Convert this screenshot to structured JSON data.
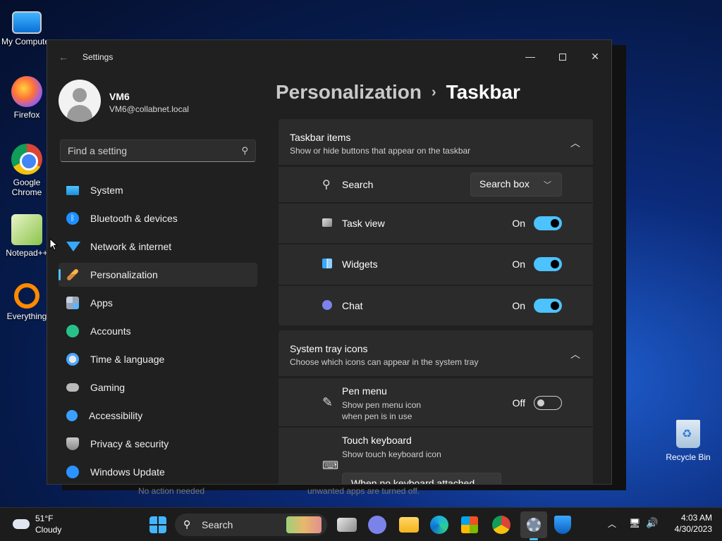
{
  "desktop": {
    "icons": [
      {
        "label": "My Computer"
      },
      {
        "label": "Firefox"
      },
      {
        "label": "Google Chrome"
      },
      {
        "label": "Notepad++"
      },
      {
        "label": "Everything"
      }
    ],
    "recycle_bin": "Recycle Bin"
  },
  "window": {
    "title": "Settings",
    "controls": {
      "minimize": "—",
      "close": "✕"
    }
  },
  "profile": {
    "name": "VM6",
    "email": "VM6@collabnet.local"
  },
  "search": {
    "placeholder": "Find a setting"
  },
  "sidebar": {
    "items": [
      {
        "label": "System",
        "icon": "system-icon"
      },
      {
        "label": "Bluetooth & devices",
        "icon": "bluetooth-icon"
      },
      {
        "label": "Network & internet",
        "icon": "wifi-icon"
      },
      {
        "label": "Personalization",
        "icon": "brush-icon",
        "active": true
      },
      {
        "label": "Apps",
        "icon": "apps-icon"
      },
      {
        "label": "Accounts",
        "icon": "person-icon"
      },
      {
        "label": "Time & language",
        "icon": "clock-globe-icon"
      },
      {
        "label": "Gaming",
        "icon": "controller-icon"
      },
      {
        "label": "Accessibility",
        "icon": "accessibility-icon"
      },
      {
        "label": "Privacy & security",
        "icon": "shield-icon"
      },
      {
        "label": "Windows Update",
        "icon": "update-icon"
      }
    ]
  },
  "breadcrumb": {
    "parent": "Personalization",
    "separator": "›",
    "current": "Taskbar"
  },
  "taskbar_items": {
    "title": "Taskbar items",
    "subtitle": "Show or hide buttons that appear on the taskbar",
    "search": {
      "label": "Search",
      "value": "Search box"
    },
    "rows": [
      {
        "label": "Task view",
        "state": "On"
      },
      {
        "label": "Widgets",
        "state": "On"
      },
      {
        "label": "Chat",
        "state": "On"
      }
    ]
  },
  "system_tray": {
    "title": "System tray icons",
    "subtitle": "Choose which icons can appear in the system tray",
    "pen_menu": {
      "label": "Pen menu",
      "sub1": "Show pen menu icon",
      "sub2": "when pen is in use",
      "state": "Off"
    },
    "touch_keyboard": {
      "label": "Touch keyboard",
      "sub": "Show touch keyboard icon",
      "value": "When no keyboard attached"
    }
  },
  "background_text": {
    "left": "No action needed",
    "right": "unwanted apps are turned off."
  },
  "taskbar": {
    "weather_temp": "51°F",
    "weather_cond": "Cloudy",
    "search_label": "Search",
    "time": "4:03 AM",
    "date": "4/30/2023"
  },
  "colors": {
    "accent": "#4cc2ff",
    "window_bg": "#202020",
    "panel_bg": "#2b2b2b"
  }
}
